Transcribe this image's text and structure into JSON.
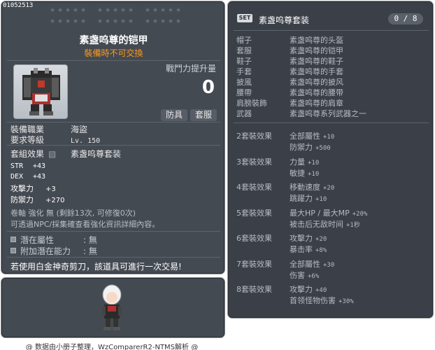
{
  "item": {
    "id": "01052513",
    "name": "素盏呜尊的铠甲",
    "trade": "裝備時不可交換",
    "power_label": "戰鬥力提升量",
    "power_value": "0",
    "tags": [
      "防具",
      "套服"
    ],
    "job_label": "裝備職業",
    "job_value": "海盜",
    "level_label": "要求等級",
    "level_value": "Lv. 150",
    "set_label": "套組效果",
    "set_value": "素盏呜尊套装",
    "stats": [
      {
        "key": "STR",
        "val": "+43"
      },
      {
        "key": "DEX",
        "val": "+43"
      },
      {
        "key": "攻擊力",
        "val": "+3"
      },
      {
        "key": "防禦力",
        "val": "+270"
      }
    ],
    "scroll_line": "卷軸 強化 無 (剩餘13次, 可修復0次)",
    "npc_line": "可透過NPC/採集確查看強化資訊詳細內容。",
    "potentials": [
      {
        "label": "潛在屬性",
        "value": ": 無"
      },
      {
        "label": "附加潛在能力",
        "value": ": 無"
      }
    ],
    "notice": "若使用白金神奇剪刀，該道具可進行一次交易!"
  },
  "set": {
    "badge": "SET",
    "title": "素盏呜尊套装",
    "count": "0 / 8",
    "pieces": [
      {
        "slot": "帽子",
        "name": "素盏呜尊的头盔"
      },
      {
        "slot": "套服",
        "name": "素盏呜尊的铠甲"
      },
      {
        "slot": "鞋子",
        "name": "素盏呜尊的鞋子"
      },
      {
        "slot": "手套",
        "name": "素盏呜尊的手套"
      },
      {
        "slot": "披風",
        "name": "素盏呜尊的披风"
      },
      {
        "slot": "腰帶",
        "name": "素盏呜尊的腰带"
      },
      {
        "slot": "肩膀裝飾",
        "name": "素盏呜尊的肩章"
      },
      {
        "slot": "武器",
        "name": "素盏呜尊系列武器之一"
      }
    ],
    "bonuses": [
      {
        "title": "2套裝效果",
        "lines": [
          {
            "k": "全部屬性",
            "v": "+10"
          },
          {
            "k": "防禦力",
            "v": "+500"
          }
        ]
      },
      {
        "title": "3套裝效果",
        "lines": [
          {
            "k": "力量",
            "v": "+10"
          },
          {
            "k": "敏捷",
            "v": "+10"
          }
        ]
      },
      {
        "title": "4套裝效果",
        "lines": [
          {
            "k": "移動速度",
            "v": "+20"
          },
          {
            "k": "跳躍力",
            "v": "+10"
          }
        ]
      },
      {
        "title": "5套裝效果",
        "lines": [
          {
            "k": "最大HP / 最大MP",
            "v": "+20%"
          },
          {
            "k": "被击后无敌时间",
            "v": "+1秒"
          }
        ]
      },
      {
        "title": "6套裝效果",
        "lines": [
          {
            "k": "攻擊力",
            "v": "+20"
          },
          {
            "k": "暴击率",
            "v": "+8%"
          }
        ]
      },
      {
        "title": "7套裝效果",
        "lines": [
          {
            "k": "全部屬性",
            "v": "+30"
          },
          {
            "k": "伤害",
            "v": "+6%"
          }
        ]
      },
      {
        "title": "8套裝效果",
        "lines": [
          {
            "k": "攻擊力",
            "v": "+40"
          },
          {
            "k": "首领怪物伤害",
            "v": "+30%"
          }
        ]
      }
    ]
  },
  "footer": "@ 数据由小册子整理，WzComparerR2-NTMS解析 @"
}
